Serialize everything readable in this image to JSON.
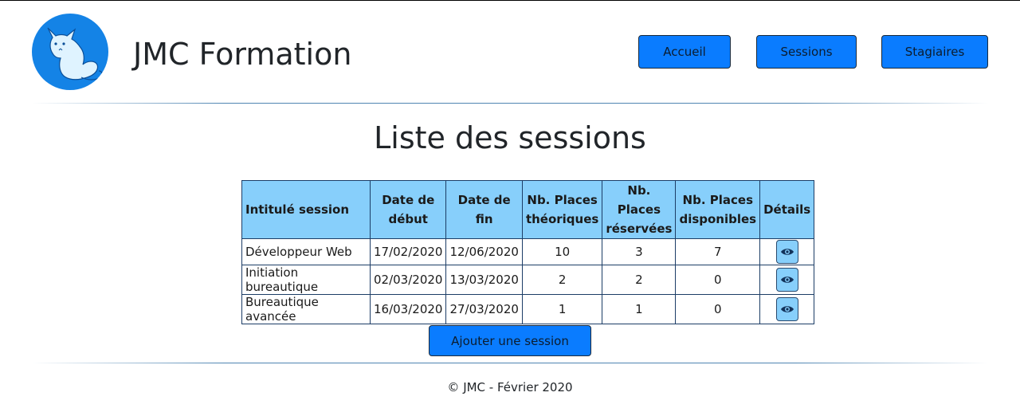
{
  "header": {
    "brand": "JMC Formation",
    "logo_icon": "cat-icon",
    "nav": [
      {
        "label": "Accueil"
      },
      {
        "label": "Sessions"
      },
      {
        "label": "Stagiaires"
      }
    ]
  },
  "main": {
    "title": "Liste des sessions",
    "table": {
      "headers": {
        "intitule": "Intitulé session",
        "debut_1": "Date de",
        "debut_2": "début",
        "fin_1": "Date de",
        "fin_2": "fin",
        "theo_1": "Nb. Places",
        "theo_2": "théoriques",
        "res_1": "Nb. Places",
        "res_2": "réservées",
        "dispo_1": "Nb. Places",
        "dispo_2": "disponibles",
        "details": "Détails"
      },
      "rows": [
        {
          "intitule": "Développeur Web",
          "debut": "17/02/2020",
          "fin": "12/06/2020",
          "theo": "10",
          "res": "3",
          "dispo": "7"
        },
        {
          "intitule": "Initiation bureautique",
          "debut": "02/03/2020",
          "fin": "13/03/2020",
          "theo": "2",
          "res": "2",
          "dispo": "0"
        },
        {
          "intitule": "Bureautique avancée",
          "debut": "16/03/2020",
          "fin": "27/03/2020",
          "theo": "1",
          "res": "1",
          "dispo": "0"
        }
      ],
      "details_icon": "eye-icon"
    },
    "add_button": "Ajouter une session"
  },
  "footer": {
    "text": "© JMC - Février 2020"
  },
  "colors": {
    "primary": "#0a7cff",
    "table_header": "#87cffb",
    "logo_bg": "#1483e6"
  }
}
